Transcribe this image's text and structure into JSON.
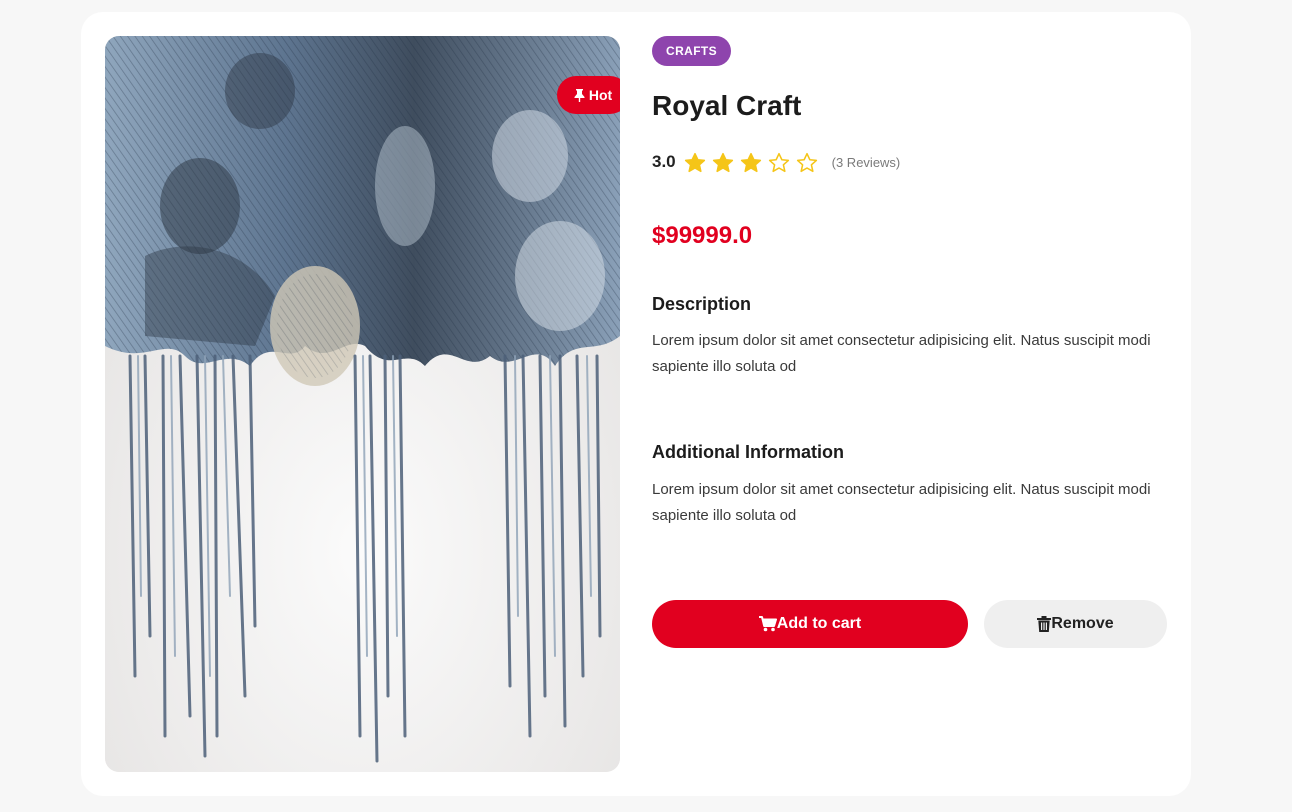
{
  "product": {
    "badge_label": "Hot",
    "category": "CRAFTS",
    "title": "Royal Craft",
    "rating_value": "3.0",
    "rating_stars": 3,
    "rating_max": 5,
    "reviews": "(3 Reviews)",
    "price": "$99999.0",
    "image_alt": "Distressed denim fabric with faded photographic print and frayed threads"
  },
  "sections": {
    "description_title": "Description",
    "description_text": "Lorem ipsum dolor sit amet consectetur adipisicing elit. Natus suscipit modi sapiente illo soluta od",
    "additional_title": "Additional Information",
    "additional_text": "Lorem ipsum dolor sit amet consectetur adipisicing elit. Natus suscipit modi sapiente illo soluta od"
  },
  "actions": {
    "add_to_cart": "Add to cart",
    "remove": "Remove"
  },
  "colors": {
    "accent": "#e1001f",
    "category": "#8e44ad",
    "star": "#f5c518",
    "remove_bg": "#efefef"
  },
  "icons": {
    "badge": "pin-icon",
    "cart": "cart-icon",
    "remove": "trash-icon",
    "star_filled": "star-filled-icon",
    "star_empty": "star-outline-icon"
  }
}
